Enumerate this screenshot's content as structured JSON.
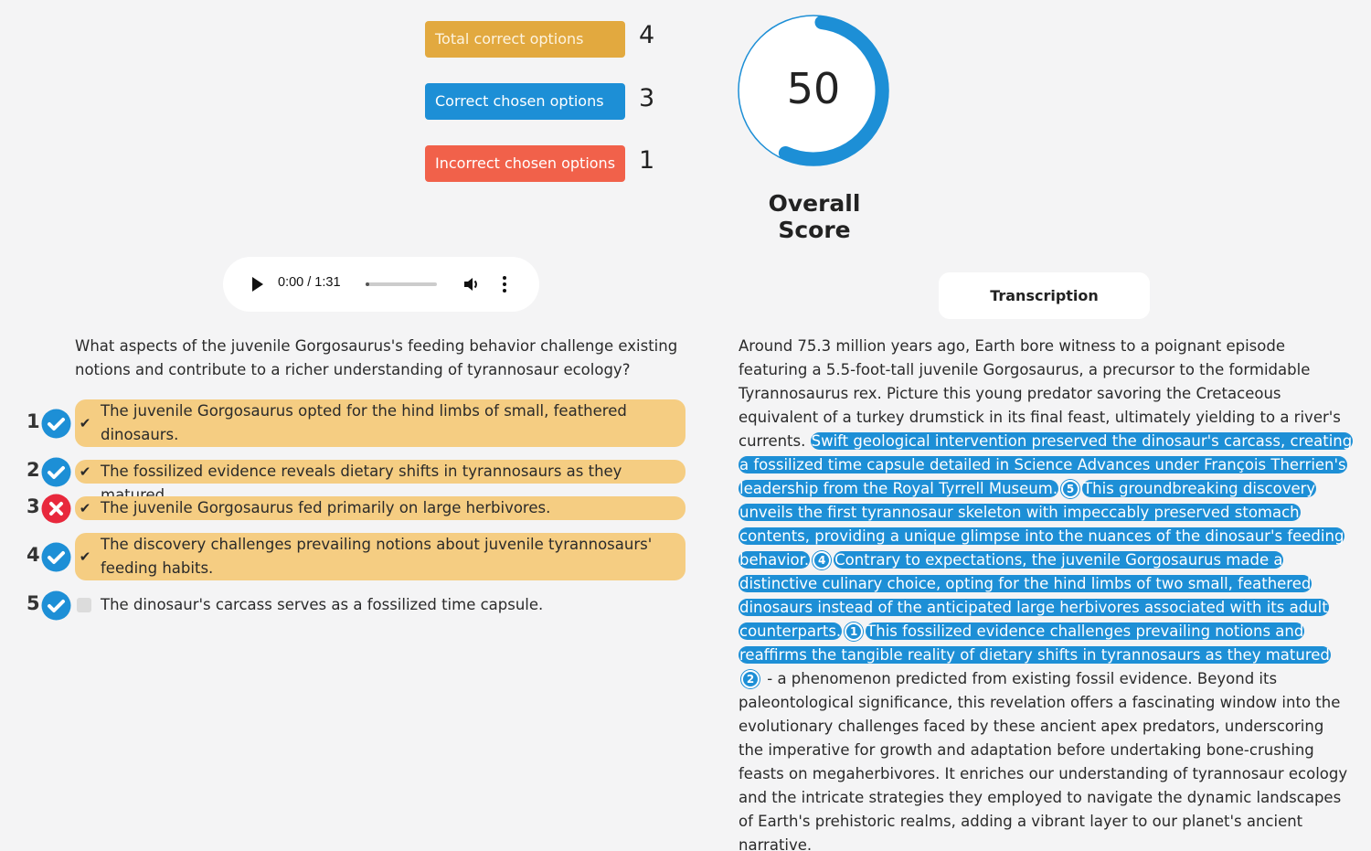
{
  "stats": {
    "total_correct": {
      "label": "Total correct options",
      "value": "4",
      "color": "#e2a93f"
    },
    "correct_chosen": {
      "label": "Correct chosen options",
      "value": "3",
      "color": "#1d8fd6"
    },
    "incorrect_chosen": {
      "label": "Incorrect chosen options",
      "value": "1",
      "color": "#f1614a"
    }
  },
  "score": {
    "value": "50",
    "percent": 50,
    "label": "Overall Score",
    "color": "#1d8fd6"
  },
  "audio": {
    "time": "0:00 / 1:31",
    "progress": 0
  },
  "question": "What aspects of the juvenile Gorgosaurus's feeding behavior challenge existing notions and contribute to a richer understanding of tyrannosaur ecology?",
  "options": [
    {
      "number": "1",
      "text": "The juvenile Gorgosaurus opted for the hind limbs of small, feathered dinosaurs.",
      "result": "correct",
      "chosen": true
    },
    {
      "number": "2",
      "text": "The fossilized evidence reveals dietary shifts in tyrannosaurs as they matured.",
      "result": "correct",
      "chosen": true
    },
    {
      "number": "3",
      "text": "The juvenile Gorgosaurus fed primarily on large herbivores.",
      "result": "incorrect",
      "chosen": true
    },
    {
      "number": "4",
      "text": "The discovery challenges prevailing notions about juvenile tyrannosaurs' feeding habits.",
      "result": "correct",
      "chosen": true
    },
    {
      "number": "5",
      "text": "The dinosaur's carcass serves as a fossilized time capsule.",
      "result": "correct",
      "chosen": false
    }
  ],
  "transcription": {
    "button_label": "Transcription",
    "segments": [
      {
        "text": "Around 75.3 million years ago, Earth bore witness to a poignant episode featuring a 5.5-foot-tall juvenile Gorgosaurus, a precursor to the formidable Tyrannosaurus rex. Picture this young predator savoring the Cretaceous equivalent of a turkey drumstick in its final feast, ultimately yielding to a river's currents. "
      },
      {
        "text": "Swift geological intervention preserved the dinosaur's carcass, creating a fossilized time capsule detailed in Science Advances under François Therrien's leadership from the Royal Tyrrell Museum.",
        "highlight": true,
        "ref": "5"
      },
      {
        "text": "This groundbreaking discovery unveils the first tyrannosaur skeleton with impeccably preserved stomach contents, providing a unique glimpse into the nuances of the dinosaur's feeding behavior.",
        "highlight": true,
        "ref": "4"
      },
      {
        "text": "Contrary to expectations, the juvenile Gorgosaurus made a distinctive culinary choice, opting for the hind limbs of two small, feathered dinosaurs instead of the anticipated large herbivores associated with its adult counterparts.",
        "highlight": true,
        "ref": "1"
      },
      {
        "text": "This fossilized evidence challenges prevailing notions and reaffirms the tangible reality of dietary shifts in tyrannosaurs as they matured",
        "highlight": true,
        "ref": "2"
      },
      {
        "text": " - a phenomenon predicted from existing fossil evidence. Beyond its paleontological significance,  this revelation offers a fascinating window into the evolutionary challenges faced by these ancient apex predators, underscoring the imperative for growth and adaptation before undertaking bone-crushing feasts on megaherbivores. It enriches our understanding of tyrannosaur ecology and the intricate strategies they employed to navigate the dynamic landscapes of Earth's prehistoric realms, adding a vibrant layer to our planet's ancient narrative."
      }
    ]
  }
}
